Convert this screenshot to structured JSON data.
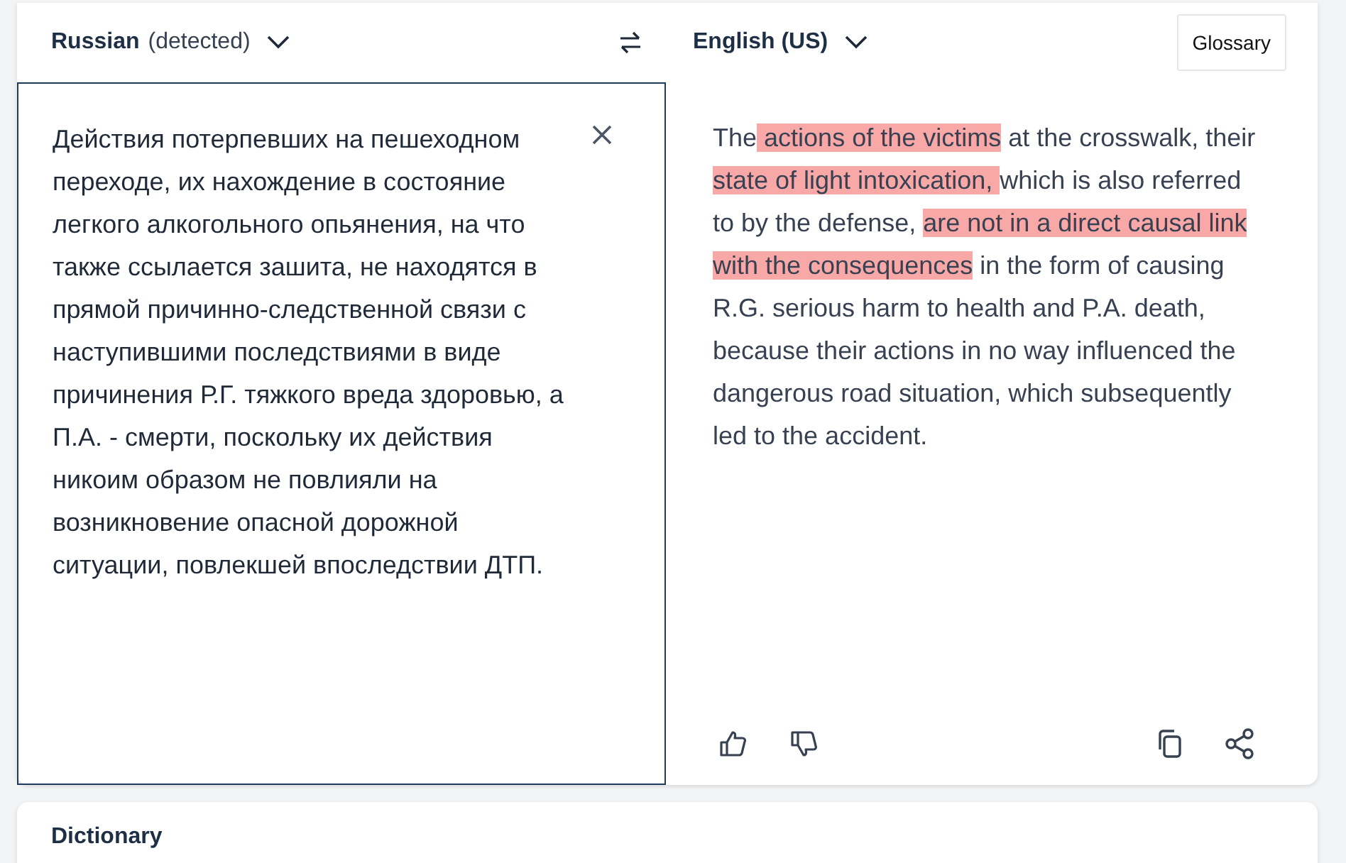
{
  "source_language": {
    "name": "Russian",
    "note": "(detected)"
  },
  "target_language": {
    "name": "English (US)"
  },
  "glossary_button": "Glossary",
  "source_text": "Действия потерпевших на пешеходном переходе, их нахождение в состояние легкого алкогольного опьянения, на что также ссылается зашита, не находятся в прямой причинно-следственной связи с наступившими последствиями в виде причинения Р.Г. тяжкого вреда здоровью, а П.А. - смерти, поскольку их действия никоим образом не повлияли на возникновение опасной дорожной ситуации, повлекшей впоследствии ДТП.",
  "translation": [
    {
      "text": "The",
      "highlighted": false
    },
    {
      "text": " actions of the victims",
      "highlighted": true
    },
    {
      "text": " at the crosswalk, their ",
      "highlighted": false
    },
    {
      "text": "state of light intoxication, ",
      "highlighted": true
    },
    {
      "text": "which is also referred to by the defense, ",
      "highlighted": false
    },
    {
      "text": "are not in a direct causal link with the consequences",
      "highlighted": true
    },
    {
      "text": " in the form of causing R.G. serious harm to health and P.A. death, because their actions in no way influenced the dangerous road situation, which subsequently led to the accident.",
      "highlighted": false
    }
  ],
  "dictionary": {
    "title": "Dictionary"
  }
}
